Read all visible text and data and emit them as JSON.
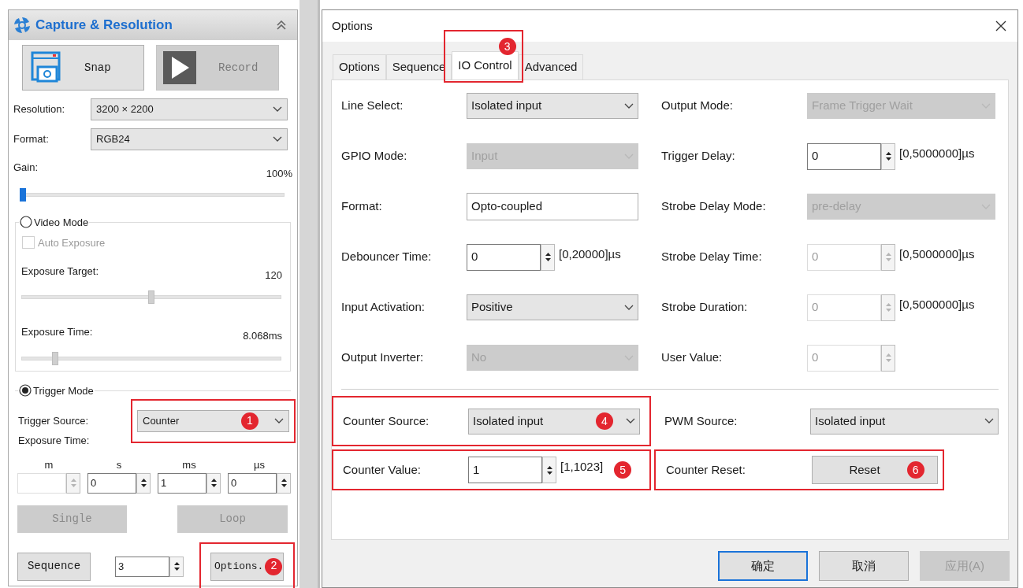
{
  "panel": {
    "title": "Capture & Resolution",
    "snap_button": "Snap",
    "record_button": "Record",
    "resolution": {
      "label": "Resolution:",
      "value": "3200 × 2200"
    },
    "format": {
      "label": "Format:",
      "value": "RGB24"
    },
    "gain": {
      "label": "Gain:",
      "reading": "100%",
      "level": 0.0,
      "focused": true
    },
    "video_mode": {
      "label": "Video Mode",
      "selected": false,
      "auto_exposure": {
        "label": "Auto Exposure",
        "checked": false,
        "disabled": true
      },
      "sliders": [
        {
          "label": "Exposure Target:",
          "reading": "120",
          "level": 0.5,
          "focused": false
        },
        {
          "label": "Exposure Time:",
          "reading": "8.068ms",
          "level": 0.12,
          "focused": false
        }
      ]
    },
    "trigger_mode": {
      "label": "Trigger Mode",
      "selected": true,
      "trigger_source": {
        "label": "Trigger Source:",
        "value": "Counter",
        "callout": "1"
      },
      "exposure_label": "Exposure Time:",
      "units": [
        {
          "label": "m",
          "disabled": true
        },
        {
          "label": "s",
          "value": "0",
          "disabled": false
        },
        {
          "label": "ms",
          "value": "1",
          "disabled": false
        },
        {
          "label": "µs",
          "value": "0",
          "disabled": false
        }
      ],
      "buttons": [
        {
          "label": "Single",
          "disabled": true
        },
        {
          "label": "Loop",
          "disabled": true
        }
      ],
      "sequence_button": "Sequence",
      "sequence_count": "3",
      "options_button": {
        "label": "Options.",
        "callout": "2"
      }
    }
  },
  "dialog": {
    "title": "Options",
    "tabs": [
      {
        "label": "Options",
        "selected": false
      },
      {
        "label": "Sequence",
        "selected": false
      },
      {
        "label": "IO Control",
        "selected": true,
        "callout": "3"
      },
      {
        "label": "Advanced",
        "selected": false
      }
    ],
    "left_fields": [
      {
        "kind": "dropdown",
        "label": "Line Select:",
        "value": "Isolated input",
        "disabled": false
      },
      {
        "kind": "dropdown",
        "label": "GPIO Mode:",
        "value": "Input",
        "disabled": true
      },
      {
        "kind": "text",
        "label": "Format:",
        "value": "Opto-coupled"
      },
      {
        "kind": "spin",
        "label": "Debouncer Time:",
        "value": "0",
        "range": "[0,20000]µs",
        "disabled": false
      },
      {
        "kind": "dropdown",
        "label": "Input Activation:",
        "value": "Positive",
        "disabled": false
      },
      {
        "kind": "dropdown",
        "label": "Output Inverter:",
        "value": "No",
        "disabled": true
      }
    ],
    "right_fields": [
      {
        "kind": "dropdown",
        "label": "Output Mode:",
        "value": "Frame Trigger Wait",
        "disabled": true
      },
      {
        "kind": "spin",
        "label": "Trigger Delay:",
        "value": "0",
        "range": "[0,5000000]µs",
        "disabled": false
      },
      {
        "kind": "dropdown",
        "label": "Strobe Delay Mode:",
        "value": "pre-delay",
        "disabled": true
      },
      {
        "kind": "spin",
        "label": "Strobe Delay Time:",
        "value": "0",
        "range": "[0,5000000]µs",
        "disabled": true
      },
      {
        "kind": "spin",
        "label": "Strobe Duration:",
        "value": "0",
        "range": "[0,5000000]µs",
        "disabled": true
      },
      {
        "kind": "spin",
        "label": "User Value:",
        "value": "0",
        "disabled": true
      }
    ],
    "counter_fields": [
      {
        "kind": "dropdown",
        "label": "Counter Source:",
        "value": "Isolated input",
        "disabled": false,
        "callout": "4"
      },
      {
        "kind": "dropdown",
        "label": "PWM Source:",
        "value": "Isolated input",
        "disabled": false
      },
      {
        "kind": "spin",
        "label": "Counter Value:",
        "value": "1",
        "range": "[1,1023]",
        "disabled": false,
        "callout": "5"
      },
      {
        "kind": "button",
        "label": "Counter Reset:",
        "value": "Reset",
        "callout": "6"
      }
    ],
    "buttons": [
      {
        "label": "确定",
        "default": true,
        "disabled": false
      },
      {
        "label": "取消",
        "default": false,
        "disabled": false
      },
      {
        "label": "应用(A)",
        "default": false,
        "disabled": true
      }
    ]
  }
}
